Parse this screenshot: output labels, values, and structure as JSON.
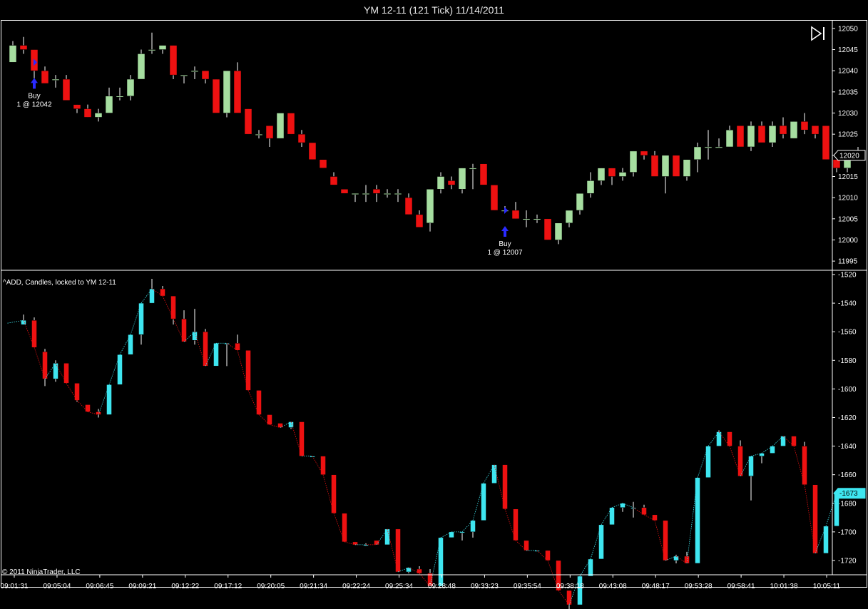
{
  "window": {
    "title": "YM 12-11 (121 Tick)  11/14/2011"
  },
  "footer": {
    "copyright": "© 2011 NinjaTrader, LLC"
  },
  "colors": {
    "up": "#a6dea0",
    "down": "#ee1111",
    "add_up": "#3ee6f0",
    "add_down": "#ee1111",
    "axis": "#ffffff",
    "background": "#000000",
    "marker": "#2a2aff"
  },
  "chart_data": [
    {
      "type": "candlestick",
      "title": "YM 12-11 (121 Tick)  11/14/2011",
      "ylim": [
        11993,
        12052
      ],
      "y_ticks": [
        11995,
        12000,
        12005,
        12010,
        12015,
        12020,
        12025,
        12030,
        12035,
        12040,
        12045,
        12050
      ],
      "last_price_label": "12020",
      "last_price": 12020,
      "candles": [
        {
          "o": 12042,
          "h": 12047,
          "l": 12042,
          "c": 12046
        },
        {
          "o": 12046,
          "h": 12048,
          "l": 12044,
          "c": 12045
        },
        {
          "o": 12045,
          "h": 12045,
          "l": 12036,
          "c": 12040
        },
        {
          "o": 12040,
          "h": 12041,
          "l": 12037,
          "c": 12037
        },
        {
          "o": 12038,
          "h": 12039,
          "l": 12036,
          "c": 12038
        },
        {
          "o": 12038,
          "h": 12039,
          "l": 12033,
          "c": 12033
        },
        {
          "o": 12032,
          "h": 12032,
          "l": 12030,
          "c": 12031
        },
        {
          "o": 12031,
          "h": 12032,
          "l": 12029,
          "c": 12029
        },
        {
          "o": 12029,
          "h": 12031,
          "l": 12028,
          "c": 12030
        },
        {
          "o": 12030,
          "h": 12036,
          "l": 12030,
          "c": 12034
        },
        {
          "o": 12034,
          "h": 12036,
          "l": 12033,
          "c": 12034
        },
        {
          "o": 12034,
          "h": 12039,
          "l": 12033,
          "c": 12038
        },
        {
          "o": 12038,
          "h": 12045,
          "l": 12038,
          "c": 12044
        },
        {
          "o": 12045,
          "h": 12049,
          "l": 12044,
          "c": 12045
        },
        {
          "o": 12045,
          "h": 12046,
          "l": 12044,
          "c": 12046
        },
        {
          "o": 12046,
          "h": 12046,
          "l": 12038,
          "c": 12039
        },
        {
          "o": 12039,
          "h": 12039,
          "l": 12037,
          "c": 12039
        },
        {
          "o": 12040,
          "h": 12041,
          "l": 12038,
          "c": 12040
        },
        {
          "o": 12040,
          "h": 12040,
          "l": 12037,
          "c": 12038
        },
        {
          "o": 12038,
          "h": 12038,
          "l": 12030,
          "c": 12030
        },
        {
          "o": 12030,
          "h": 12040,
          "l": 12029,
          "c": 12040
        },
        {
          "o": 12040,
          "h": 12042,
          "l": 12030,
          "c": 12030
        },
        {
          "o": 12031,
          "h": 12031,
          "l": 12025,
          "c": 12025
        },
        {
          "o": 12025,
          "h": 12026,
          "l": 12024,
          "c": 12025
        },
        {
          "o": 12027,
          "h": 12027,
          "l": 12022,
          "c": 12024
        },
        {
          "o": 12024,
          "h": 12030,
          "l": 12024,
          "c": 12030
        },
        {
          "o": 12030,
          "h": 12030,
          "l": 12025,
          "c": 12025
        },
        {
          "o": 12025,
          "h": 12026,
          "l": 12022,
          "c": 12023
        },
        {
          "o": 12023,
          "h": 12023,
          "l": 12019,
          "c": 12019
        },
        {
          "o": 12019,
          "h": 12019,
          "l": 12017,
          "c": 12017
        },
        {
          "o": 12015,
          "h": 12016,
          "l": 12013,
          "c": 12013
        },
        {
          "o": 12012,
          "h": 12012,
          "l": 12011,
          "c": 12011
        },
        {
          "o": 12011,
          "h": 12011,
          "l": 12009,
          "c": 12011
        },
        {
          "o": 12011,
          "h": 12013,
          "l": 12009,
          "c": 12011
        },
        {
          "o": 12012,
          "h": 12013,
          "l": 12009,
          "c": 12011
        },
        {
          "o": 12011,
          "h": 12012,
          "l": 12010,
          "c": 12011
        },
        {
          "o": 12011,
          "h": 12012,
          "l": 12009,
          "c": 12011
        },
        {
          "o": 12010,
          "h": 12011,
          "l": 12006,
          "c": 12006
        },
        {
          "o": 12006,
          "h": 12007,
          "l": 12003,
          "c": 12003
        },
        {
          "o": 12004,
          "h": 12012,
          "l": 12002,
          "c": 12012
        },
        {
          "o": 12012,
          "h": 12016,
          "l": 12011,
          "c": 12015
        },
        {
          "o": 12014,
          "h": 12015,
          "l": 12012,
          "c": 12013
        },
        {
          "o": 12012,
          "h": 12017,
          "l": 12011,
          "c": 12017
        },
        {
          "o": 12017,
          "h": 12018,
          "l": 12012,
          "c": 12017
        },
        {
          "o": 12018,
          "h": 12018,
          "l": 12013,
          "c": 12013
        },
        {
          "o": 12013,
          "h": 12013,
          "l": 12007,
          "c": 12007
        },
        {
          "o": 12007,
          "h": 12008,
          "l": 12007,
          "c": 12007
        },
        {
          "o": 12007,
          "h": 12009,
          "l": 12005,
          "c": 12005
        },
        {
          "o": 12005,
          "h": 12007,
          "l": 12003,
          "c": 12005
        },
        {
          "o": 12005,
          "h": 12006,
          "l": 12004,
          "c": 12005
        },
        {
          "o": 12005,
          "h": 12005,
          "l": 12000,
          "c": 12000
        },
        {
          "o": 12000,
          "h": 12004,
          "l": 11999,
          "c": 12004
        },
        {
          "o": 12004,
          "h": 12007,
          "l": 12003,
          "c": 12007
        },
        {
          "o": 12007,
          "h": 12011,
          "l": 12006,
          "c": 12011
        },
        {
          "o": 12011,
          "h": 12016,
          "l": 12010,
          "c": 12014
        },
        {
          "o": 12014,
          "h": 12017,
          "l": 12013,
          "c": 12017
        },
        {
          "o": 12017,
          "h": 12017,
          "l": 12013,
          "c": 12015
        },
        {
          "o": 12015,
          "h": 12017,
          "l": 12014,
          "c": 12016
        },
        {
          "o": 12016,
          "h": 12021,
          "l": 12015,
          "c": 12021
        },
        {
          "o": 12021,
          "h": 12021,
          "l": 12019,
          "c": 12020
        },
        {
          "o": 12020,
          "h": 12021,
          "l": 12015,
          "c": 12015
        },
        {
          "o": 12015,
          "h": 12020,
          "l": 12011,
          "c": 12020
        },
        {
          "o": 12020,
          "h": 12020,
          "l": 12015,
          "c": 12015
        },
        {
          "o": 12015,
          "h": 12019,
          "l": 12014,
          "c": 12019
        },
        {
          "o": 12019,
          "h": 12023,
          "l": 12016,
          "c": 12022
        },
        {
          "o": 12022,
          "h": 12026,
          "l": 12019,
          "c": 12022
        },
        {
          "o": 12022,
          "h": 12024,
          "l": 12022,
          "c": 12022
        },
        {
          "o": 12022,
          "h": 12027,
          "l": 12022,
          "c": 12026
        },
        {
          "o": 12027,
          "h": 12027,
          "l": 12022,
          "c": 12022
        },
        {
          "o": 12022,
          "h": 12028,
          "l": 12021,
          "c": 12027
        },
        {
          "o": 12027,
          "h": 12028,
          "l": 12023,
          "c": 12023
        },
        {
          "o": 12023,
          "h": 12028,
          "l": 12022,
          "c": 12027
        },
        {
          "o": 12027,
          "h": 12029,
          "l": 12024,
          "c": 12025
        },
        {
          "o": 12024,
          "h": 12028,
          "l": 12024,
          "c": 12028
        },
        {
          "o": 12028,
          "h": 12030,
          "l": 12025,
          "c": 12026
        },
        {
          "o": 12027,
          "h": 12027,
          "l": 12024,
          "c": 12025
        },
        {
          "o": 12027,
          "h": 12027,
          "l": 12019,
          "c": 12019
        },
        {
          "o": 12019,
          "h": 12019,
          "l": 12016,
          "c": 12017
        },
        {
          "o": 12017,
          "h": 12020,
          "l": 12016,
          "c": 12020
        },
        {
          "o": 12020,
          "h": 12022,
          "l": 12019,
          "c": 12021
        }
      ],
      "annotations": [
        {
          "index": 2,
          "price": 12042,
          "label": "Buy",
          "detail": "1 @ 12042"
        },
        {
          "index": 46,
          "price": 12007,
          "label": "Buy",
          "detail": "1 @ 12007"
        }
      ]
    },
    {
      "type": "candlestick",
      "title": "^ADD, Candles, locked to YM 12-11",
      "ylim": [
        -1730,
        -1517
      ],
      "y_ticks": [
        -1520,
        -1540,
        -1560,
        -1580,
        -1600,
        -1620,
        -1640,
        -1660,
        -1680,
        -1700,
        -1720
      ],
      "last_value_label": "-1673",
      "last_value": -1673,
      "start_value": -1554,
      "candles": [
        {
          "o": -1555,
          "h": -1548,
          "l": -1555,
          "c": -1552
        },
        {
          "o": -1552,
          "h": -1550,
          "l": -1571,
          "c": -1571
        },
        {
          "o": -1574,
          "h": -1572,
          "l": -1598,
          "c": -1593
        },
        {
          "o": -1593,
          "h": -1580,
          "l": -1595,
          "c": -1582
        },
        {
          "o": -1582,
          "h": -1582,
          "l": -1596,
          "c": -1596
        },
        {
          "o": -1596,
          "h": -1596,
          "l": -1609,
          "c": -1608
        },
        {
          "o": -1611,
          "h": -1611,
          "l": -1616,
          "c": -1616
        },
        {
          "o": -1616,
          "h": -1614,
          "l": -1620,
          "c": -1618
        },
        {
          "o": -1618,
          "h": -1597,
          "l": -1618,
          "c": -1597
        },
        {
          "o": -1597,
          "h": -1576,
          "l": -1597,
          "c": -1576
        },
        {
          "o": -1576,
          "h": -1562,
          "l": -1576,
          "c": -1562
        },
        {
          "o": -1562,
          "h": -1540,
          "l": -1569,
          "c": -1540
        },
        {
          "o": -1540,
          "h": -1523,
          "l": -1540,
          "c": -1530
        },
        {
          "o": -1530,
          "h": -1528,
          "l": -1535,
          "c": -1535
        },
        {
          "o": -1535,
          "h": -1535,
          "l": -1555,
          "c": -1551
        },
        {
          "o": -1551,
          "h": -1545,
          "l": -1567,
          "c": -1567
        },
        {
          "o": -1566,
          "h": -1544,
          "l": -1569,
          "c": -1560
        },
        {
          "o": -1560,
          "h": -1558,
          "l": -1584,
          "c": -1584
        },
        {
          "o": -1584,
          "h": -1580,
          "l": -1584,
          "c": -1568
        },
        {
          "o": -1568,
          "h": -1568,
          "l": -1584,
          "c": -1568
        },
        {
          "o": -1568,
          "h": -1562,
          "l": -1573,
          "c": -1573
        },
        {
          "o": -1573,
          "h": -1573,
          "l": -1601,
          "c": -1601
        },
        {
          "o": -1601,
          "h": -1601,
          "l": -1618,
          "c": -1618
        },
        {
          "o": -1618,
          "h": -1618,
          "l": -1625,
          "c": -1625
        },
        {
          "o": -1624,
          "h": -1624,
          "l": -1627,
          "c": -1627
        },
        {
          "o": -1627,
          "h": -1623,
          "l": -1628,
          "c": -1623
        },
        {
          "o": -1623,
          "h": -1623,
          "l": -1647,
          "c": -1647
        },
        {
          "o": -1647,
          "h": -1647,
          "l": -1647,
          "c": -1647
        },
        {
          "o": -1647,
          "h": -1647,
          "l": -1660,
          "c": -1660
        },
        {
          "o": -1660,
          "h": -1660,
          "l": -1687,
          "c": -1687
        },
        {
          "o": -1687,
          "h": -1687,
          "l": -1707,
          "c": -1707
        },
        {
          "o": -1707,
          "h": -1707,
          "l": -1709,
          "c": -1709
        },
        {
          "o": -1709,
          "h": -1708,
          "l": -1710,
          "c": -1709
        },
        {
          "o": -1706,
          "h": -1706,
          "l": -1709,
          "c": -1709
        },
        {
          "o": -1709,
          "h": -1698,
          "l": -1709,
          "c": -1698
        },
        {
          "o": -1698,
          "h": -1698,
          "l": -1728,
          "c": -1728
        },
        {
          "o": -1728,
          "h": -1725,
          "l": -1729,
          "c": -1725
        },
        {
          "o": -1726,
          "h": -1724,
          "l": -1729,
          "c": -1729
        },
        {
          "o": -1729,
          "h": -1726,
          "l": -1738,
          "c": -1738
        },
        {
          "o": -1738,
          "h": -1704,
          "l": -1738,
          "c": -1704
        },
        {
          "o": -1704,
          "h": -1700,
          "l": -1704,
          "c": -1700
        },
        {
          "o": -1700,
          "h": -1700,
          "l": -1706,
          "c": -1700
        },
        {
          "o": -1700,
          "h": -1692,
          "l": -1704,
          "c": -1692
        },
        {
          "o": -1692,
          "h": -1666,
          "l": -1692,
          "c": -1666
        },
        {
          "o": -1666,
          "h": -1653,
          "l": -1666,
          "c": -1653
        },
        {
          "o": -1653,
          "h": -1653,
          "l": -1684,
          "c": -1684
        },
        {
          "o": -1684,
          "h": -1684,
          "l": -1706,
          "c": -1706
        },
        {
          "o": -1706,
          "h": -1706,
          "l": -1713,
          "c": -1713
        },
        {
          "o": -1713,
          "h": -1713,
          "l": -1713,
          "c": -1713
        },
        {
          "o": -1713,
          "h": -1713,
          "l": -1720,
          "c": -1720
        },
        {
          "o": -1720,
          "h": -1720,
          "l": -1741,
          "c": -1741
        },
        {
          "o": -1741,
          "h": -1741,
          "l": -1754,
          "c": -1751
        },
        {
          "o": -1751,
          "h": -1731,
          "l": -1751,
          "c": -1731
        },
        {
          "o": -1731,
          "h": -1719,
          "l": -1731,
          "c": -1719
        },
        {
          "o": -1719,
          "h": -1695,
          "l": -1719,
          "c": -1695
        },
        {
          "o": -1695,
          "h": -1683,
          "l": -1695,
          "c": -1683
        },
        {
          "o": -1683,
          "h": -1680,
          "l": -1686,
          "c": -1680
        },
        {
          "o": -1683,
          "h": -1679,
          "l": -1690,
          "c": -1683
        },
        {
          "o": -1683,
          "h": -1681,
          "l": -1688,
          "c": -1688
        },
        {
          "o": -1688,
          "h": -1688,
          "l": -1692,
          "c": -1692
        },
        {
          "o": -1692,
          "h": -1692,
          "l": -1720,
          "c": -1720
        },
        {
          "o": -1720,
          "h": -1716,
          "l": -1722,
          "c": -1717
        },
        {
          "o": -1717,
          "h": -1714,
          "l": -1722,
          "c": -1722
        },
        {
          "o": -1722,
          "h": -1662,
          "l": -1722,
          "c": -1662
        },
        {
          "o": -1662,
          "h": -1640,
          "l": -1662,
          "c": -1640
        },
        {
          "o": -1640,
          "h": -1629,
          "l": -1640,
          "c": -1630
        },
        {
          "o": -1630,
          "h": -1630,
          "l": -1640,
          "c": -1640
        },
        {
          "o": -1640,
          "h": -1636,
          "l": -1661,
          "c": -1661
        },
        {
          "o": -1661,
          "h": -1661,
          "l": -1678,
          "c": -1647
        },
        {
          "o": -1647,
          "h": -1645,
          "l": -1652,
          "c": -1645
        },
        {
          "o": -1645,
          "h": -1640,
          "l": -1645,
          "c": -1640
        },
        {
          "o": -1640,
          "h": -1633,
          "l": -1640,
          "c": -1633
        },
        {
          "o": -1633,
          "h": -1633,
          "l": -1640,
          "c": -1640
        },
        {
          "o": -1640,
          "h": -1637,
          "l": -1667,
          "c": -1667
        },
        {
          "o": -1667,
          "h": -1667,
          "l": -1715,
          "c": -1715
        },
        {
          "o": -1715,
          "h": -1696,
          "l": -1715,
          "c": -1696
        },
        {
          "o": -1696,
          "h": -1673,
          "l": -1696,
          "c": -1673
        }
      ]
    }
  ],
  "time_axis": {
    "labels": [
      "09:01:31",
      "09:05:04",
      "09:06:45",
      "09:09:21",
      "09:12:22",
      "09:17:12",
      "09:20:05",
      "09:21:34",
      "09:22:24",
      "09:25:34",
      "09:28:48",
      "09:33:23",
      "09:35:54",
      "09:38:18",
      "09:43:08",
      "09:48:17",
      "09:53:28",
      "09:58:41",
      "10:01:38",
      "10:05:11"
    ]
  }
}
